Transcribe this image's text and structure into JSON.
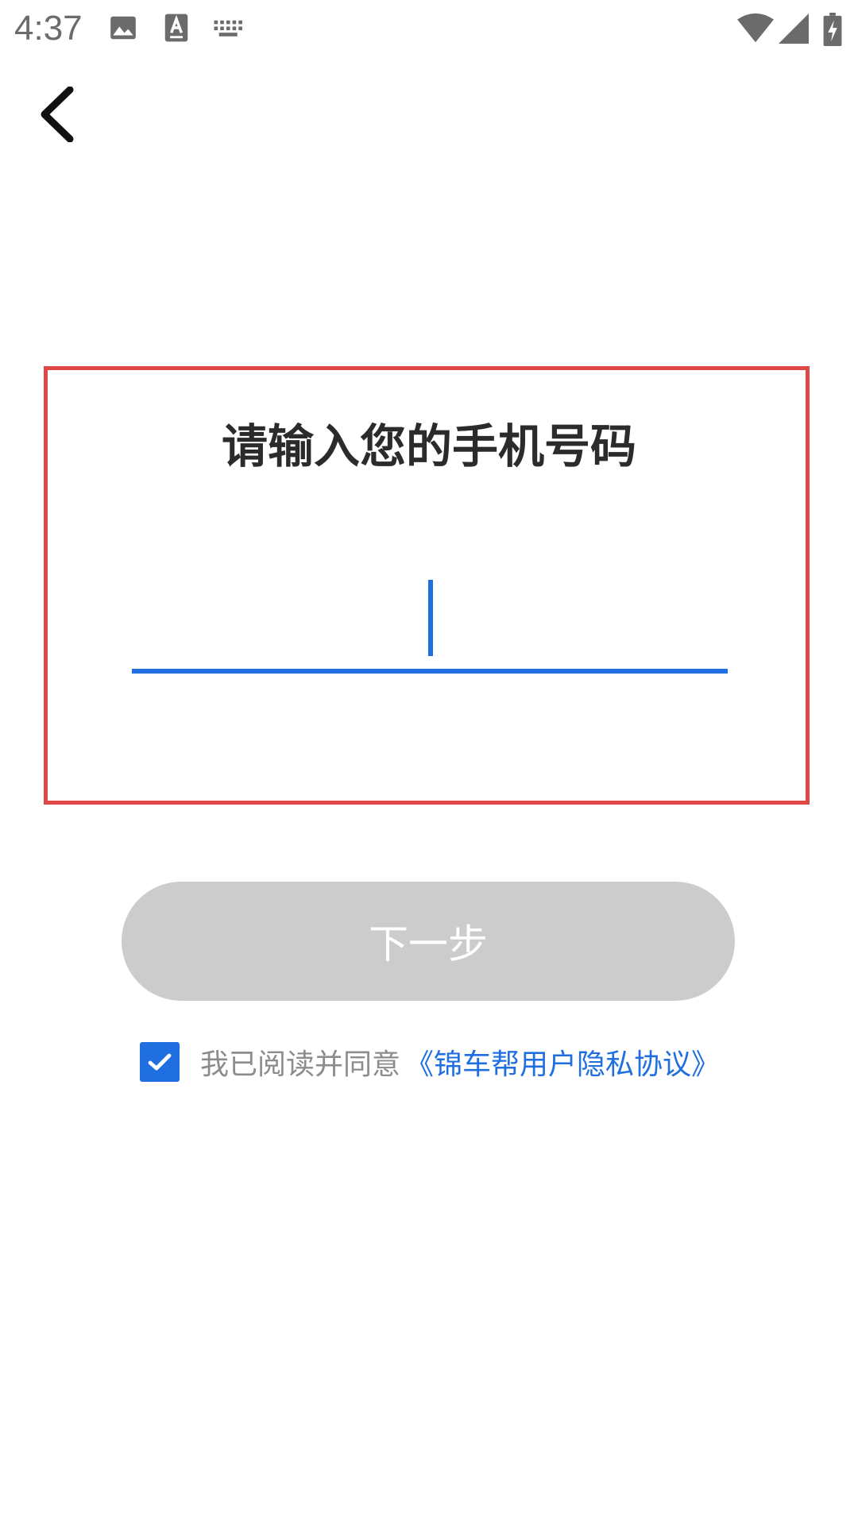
{
  "status_bar": {
    "time": "4:37",
    "icons": [
      "gallery-icon",
      "font-icon",
      "keyboard-icon",
      "wifi-icon",
      "signal-icon",
      "battery-charging-icon"
    ]
  },
  "nav": {
    "back_icon": "chevron-left-icon"
  },
  "login": {
    "title": "请输入您的手机号码",
    "phone_value": "",
    "next_label": "下一步",
    "agree_checked": true,
    "agree_text": "我已阅读并同意",
    "agree_link": "《锦车帮用户隐私协议》"
  },
  "colors": {
    "accent": "#1f6fe0",
    "button_disabled": "#cccccc",
    "highlight_frame": "#e04848",
    "title": "#2b2b2b",
    "muted_text": "#8c8c8c"
  }
}
